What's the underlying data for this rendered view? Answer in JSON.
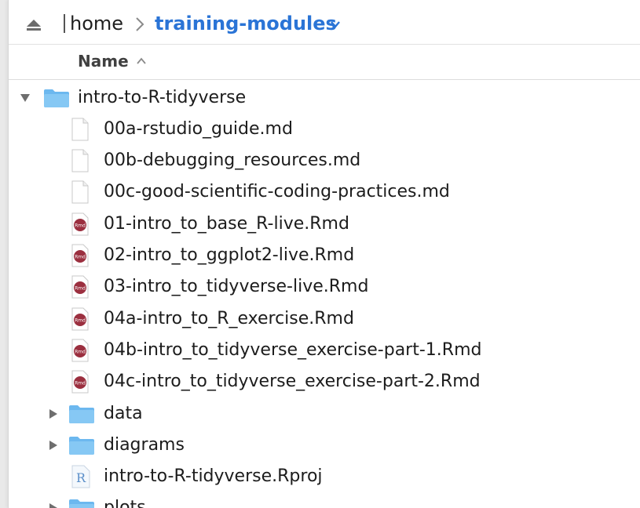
{
  "breadcrumb": {
    "home": "home",
    "current": "training-modules"
  },
  "columns": {
    "name": "Name"
  },
  "tree": {
    "root_folder": "intro-to-R-tidyverse",
    "files": [
      {
        "name": "00a-rstudio_guide.md",
        "icon": "document-icon"
      },
      {
        "name": "00b-debugging_resources.md",
        "icon": "document-icon"
      },
      {
        "name": "00c-good-scientific-coding-practices.md",
        "icon": "document-icon"
      },
      {
        "name": "01-intro_to_base_R-live.Rmd",
        "icon": "rmd-icon"
      },
      {
        "name": "02-intro_to_ggplot2-live.Rmd",
        "icon": "rmd-icon"
      },
      {
        "name": "03-intro_to_tidyverse-live.Rmd",
        "icon": "rmd-icon"
      },
      {
        "name": "04a-intro_to_R_exercise.Rmd",
        "icon": "rmd-icon"
      },
      {
        "name": "04b-intro_to_tidyverse_exercise-part-1.Rmd",
        "icon": "rmd-icon"
      },
      {
        "name": "04c-intro_to_tidyverse_exercise-part-2.Rmd",
        "icon": "rmd-icon"
      }
    ],
    "subfolders": [
      {
        "name": "data"
      },
      {
        "name": "diagrams"
      }
    ],
    "project_file": "intro-to-R-tidyverse.Rproj",
    "last_folder": "plots"
  },
  "icon_text": {
    "rmd": "Rmd",
    "rproj": "R"
  },
  "colors": {
    "accent": "#2a74d6",
    "folder": "#6cb8ef",
    "rmd_badge": "#9b2f3f"
  }
}
